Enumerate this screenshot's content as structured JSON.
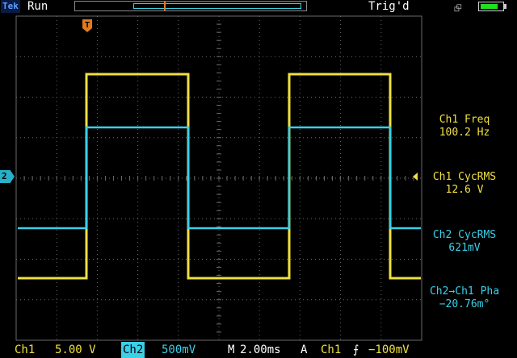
{
  "header": {
    "brand": "Tek",
    "status": "Run",
    "trigger_status": "Trig'd",
    "battery_level": 0.8,
    "power_icon": "ac-plug-icon",
    "trigger_marker": "T"
  },
  "side_readouts": [
    {
      "label": "Ch1 Freq",
      "value": "100.2 Hz",
      "color": "#f0e040"
    },
    {
      "label": "Ch1 CycRMS",
      "value": "12.6 V",
      "color": "#f0e040"
    },
    {
      "label": "Ch2 CycRMS",
      "value": "621mV",
      "color": "#3ad0e8"
    },
    {
      "label": "Ch2→Ch1 Pha",
      "value": "−20.76m°",
      "color": "#3ad0e8"
    }
  ],
  "channel_marker": "2",
  "bottom": {
    "ch1_label": "Ch1",
    "ch1_scale": "5.00 V",
    "ch2_label": "Ch2",
    "ch2_scale": "500mV",
    "timebase_label": "M",
    "timebase": "2.00ms",
    "trigger_mode": "A",
    "trigger_source": "Ch1",
    "trigger_slope_icon": "rising-edge-icon",
    "trigger_level": "−100mV"
  },
  "colors": {
    "ch1": "#f0e040",
    "ch2": "#3ad0e8",
    "grid": "#6a6a6a"
  }
}
